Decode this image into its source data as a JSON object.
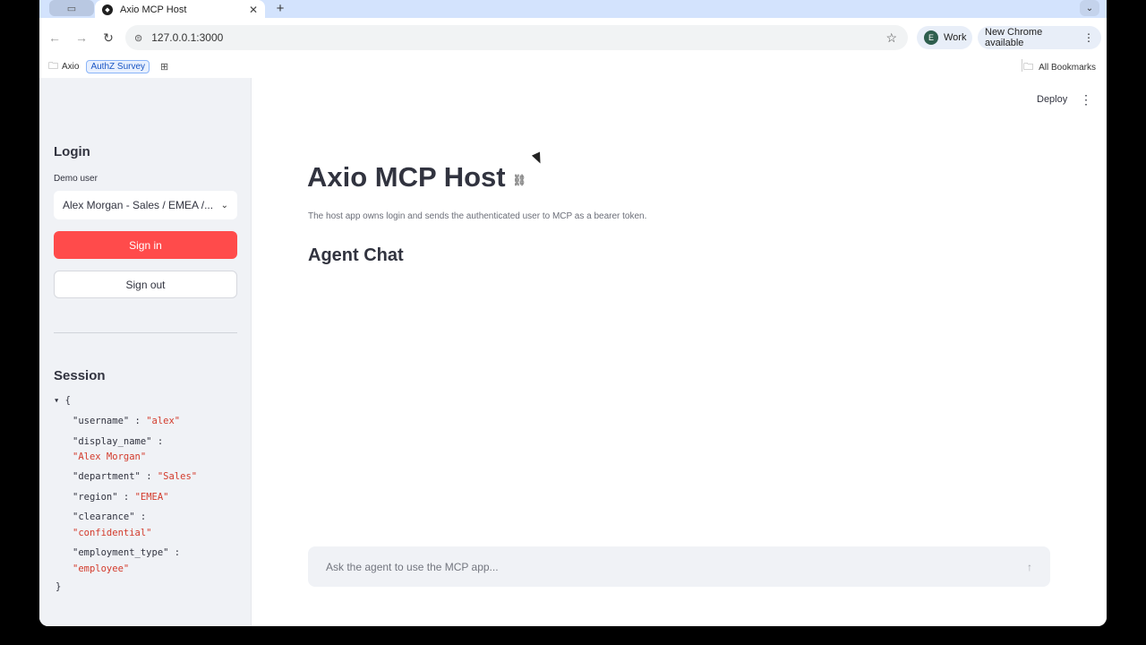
{
  "browser": {
    "tab_title": "Axio MCP Host",
    "new_tab_label": "+",
    "url": "127.0.0.1:3000",
    "profile_initial": "E",
    "profile_name": "Work",
    "update_label": "New Chrome available",
    "bookmarks": {
      "axio": "Axio",
      "authz": "AuthZ Survey",
      "all": "All Bookmarks"
    }
  },
  "sidebar": {
    "login_heading": "Login",
    "demo_user_label": "Demo user",
    "demo_user_value": "Alex Morgan - Sales / EMEA /...",
    "sign_in": "Sign in",
    "sign_out": "Sign out",
    "session_heading": "Session",
    "session": {
      "open_brace": "{",
      "close_brace": "}",
      "username_key": "\"username\"",
      "username_val": "\"alex\"",
      "display_name_key": "\"display_name\"",
      "display_name_val": "\"Alex Morgan\"",
      "department_key": "\"department\"",
      "department_val": "\"Sales\"",
      "region_key": "\"region\"",
      "region_val": "\"EMEA\"",
      "clearance_key": "\"clearance\"",
      "clearance_val": "\"confidential\"",
      "employment_type_key": "\"employment_type\"",
      "employment_type_val": "\"employee\"",
      "sep": ":"
    }
  },
  "main": {
    "deploy": "Deploy",
    "title": "Axio MCP Host",
    "caption": "The host app owns login and sends the authenticated user to MCP as a bearer token.",
    "subheader": "Agent Chat",
    "chat_placeholder": "Ask the agent to use the MCP app..."
  },
  "colors": {
    "primary": "#ff4b4b",
    "sidebar_bg": "#f0f2f6",
    "json_string": "#d33b2c"
  }
}
